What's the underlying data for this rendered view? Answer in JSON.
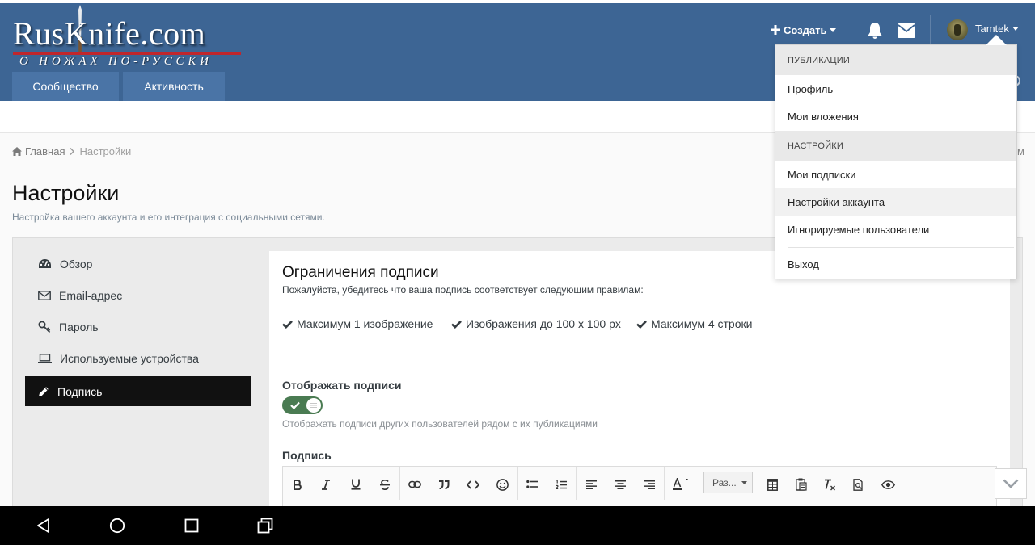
{
  "site": {
    "logo_text": "RusKnife.com",
    "logo_tagline": "О НОЖАХ ПО-РУССКИ"
  },
  "nav": {
    "tabs": [
      {
        "label": "Сообщество"
      },
      {
        "label": "Активность"
      }
    ]
  },
  "user_bar": {
    "create_label": "Создать",
    "username": "Tamtek",
    "bell_icon": "bell-icon",
    "messages_icon": "envelope-icon"
  },
  "breadcrumb": {
    "home": "Главная",
    "current": "Настройки",
    "right_fragment": "м"
  },
  "page": {
    "title": "Настройки",
    "description": "Настройка вашего аккаунта и его интеграция с социальными сетями."
  },
  "sidebar": {
    "items": [
      {
        "label": "Обзор",
        "icon": "dashboard-icon"
      },
      {
        "label": "Email-адрес",
        "icon": "envelope-icon"
      },
      {
        "label": "Пароль",
        "icon": "key-icon"
      },
      {
        "label": "Используемые устройства",
        "icon": "laptop-icon"
      },
      {
        "label": "Подпись",
        "icon": "pencil-icon",
        "active": true
      }
    ]
  },
  "signature": {
    "title": "Ограничения подписи",
    "description": "Пожалуйста, убедитесь что ваша подпись соответствует следующим правилам:",
    "rules": [
      "Максимум 1 изображение",
      "Изображения до 100 x 100 px",
      "Максимум 4 строки"
    ],
    "show_label": "Отображать подписи",
    "show_enabled": true,
    "show_hint": "Отображать подписи других пользователей рядом с их публикациями",
    "field_label": "Подпись",
    "font_size_placeholder": "Раз..."
  },
  "dropdown": {
    "sections": [
      {
        "heading": "ПУБЛИКАЦИИ",
        "items": [
          "Профиль",
          "Мои вложения"
        ]
      },
      {
        "heading": "НАСТРОЙКИ",
        "items": [
          "Мои подписки",
          "Настройки аккаунта",
          "Игнорируемые пользователи"
        ]
      }
    ],
    "logout": "Выход",
    "hovered_item": "Настройки аккаунта"
  },
  "colors": {
    "header": "#3d6594",
    "nav_tab": "#4a74a6",
    "active_sidebar": "#111111",
    "toggle_on": "#4a7b52",
    "logo_rule": "#c0262c"
  }
}
